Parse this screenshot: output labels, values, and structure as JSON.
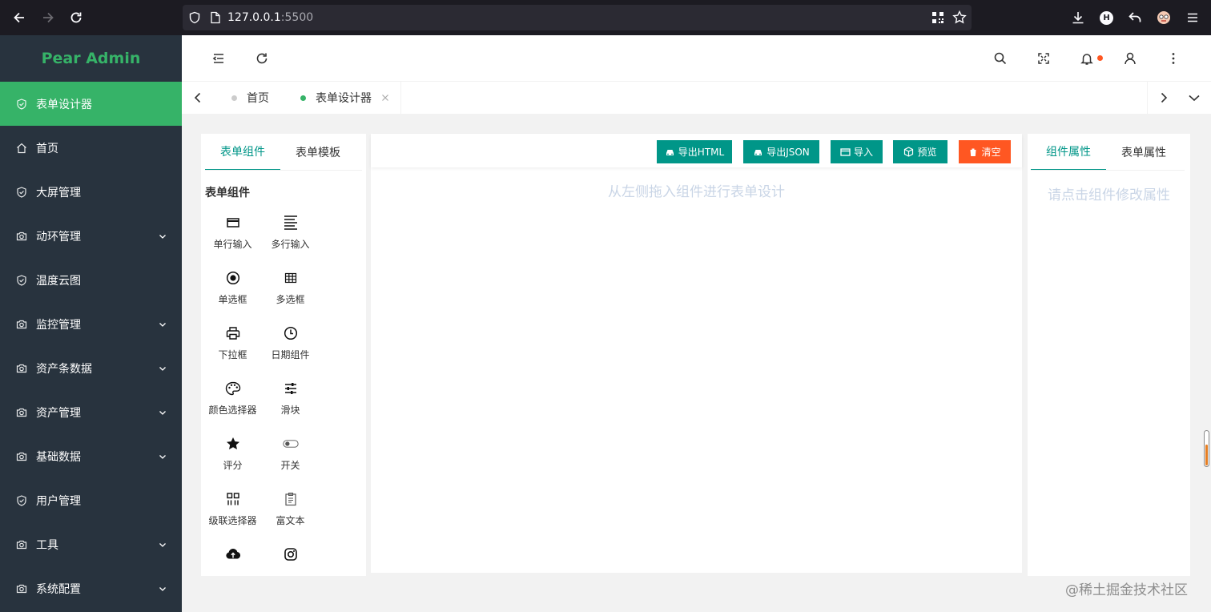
{
  "browser": {
    "url_host": "127.0.0.1",
    "url_port": ":5500"
  },
  "sidebar": {
    "logo": "Pear Admin",
    "items": [
      {
        "label": "表单设计器",
        "icon": "shield-check-icon",
        "active": true,
        "expandable": false
      },
      {
        "label": "首页",
        "icon": "home-icon",
        "active": false,
        "expandable": false
      },
      {
        "label": "大屏管理",
        "icon": "shield-check-icon",
        "active": false,
        "expandable": false
      },
      {
        "label": "动环管理",
        "icon": "camera-icon",
        "active": false,
        "expandable": true
      },
      {
        "label": "温度云图",
        "icon": "shield-check-icon",
        "active": false,
        "expandable": false
      },
      {
        "label": "监控管理",
        "icon": "camera-icon",
        "active": false,
        "expandable": true
      },
      {
        "label": "资产条数据",
        "icon": "camera-icon",
        "active": false,
        "expandable": true
      },
      {
        "label": "资产管理",
        "icon": "camera-icon",
        "active": false,
        "expandable": true
      },
      {
        "label": "基础数据",
        "icon": "camera-icon",
        "active": false,
        "expandable": true
      },
      {
        "label": "用户管理",
        "icon": "shield-check-icon",
        "active": false,
        "expandable": false
      },
      {
        "label": "工具",
        "icon": "camera-icon",
        "active": false,
        "expandable": true
      },
      {
        "label": "系统配置",
        "icon": "camera-icon",
        "active": false,
        "expandable": true
      }
    ]
  },
  "tabs": [
    {
      "label": "首页",
      "active": false,
      "closable": false
    },
    {
      "label": "表单设计器",
      "active": true,
      "closable": true
    }
  ],
  "left_panel": {
    "tabs": [
      "表单组件",
      "表单模板"
    ],
    "active_tab": "表单组件",
    "section_title": "表单组件",
    "components": [
      {
        "label": "单行输入",
        "icon": "input-line-icon"
      },
      {
        "label": "多行输入",
        "icon": "textarea-icon"
      },
      {
        "label": "单选框",
        "icon": "radio-icon"
      },
      {
        "label": "多选框",
        "icon": "checkbox-grid-icon"
      },
      {
        "label": "下拉框",
        "icon": "printer-icon"
      },
      {
        "label": "日期组件",
        "icon": "clock-icon"
      },
      {
        "label": "颜色选择器",
        "icon": "palette-icon"
      },
      {
        "label": "滑块",
        "icon": "sliders-icon"
      },
      {
        "label": "评分",
        "icon": "star-icon"
      },
      {
        "label": "开关",
        "icon": "toggle-icon"
      },
      {
        "label": "级联选择器",
        "icon": "cascade-icon"
      },
      {
        "label": "富文本",
        "icon": "document-icon"
      },
      {
        "label": "",
        "icon": "cloud-upload-icon"
      },
      {
        "label": "",
        "icon": "instagram-icon"
      }
    ]
  },
  "toolbar": {
    "export_html": "导出HTML",
    "export_json": "导出JSON",
    "import": "导入",
    "preview": "预览",
    "clear": "清空"
  },
  "center": {
    "hint": "从左侧拖入组件进行表单设计"
  },
  "right_panel": {
    "tabs": [
      "组件属性",
      "表单属性"
    ],
    "active_tab": "组件属性",
    "hint": "请点击组件修改属性"
  },
  "colors": {
    "primary": "#009688",
    "sidebar_bg": "#28333e",
    "sidebar_active": "#36b368",
    "danger": "#ff5722",
    "hint": "#c9d5e6"
  },
  "watermark": "@稀土掘金技术社区"
}
